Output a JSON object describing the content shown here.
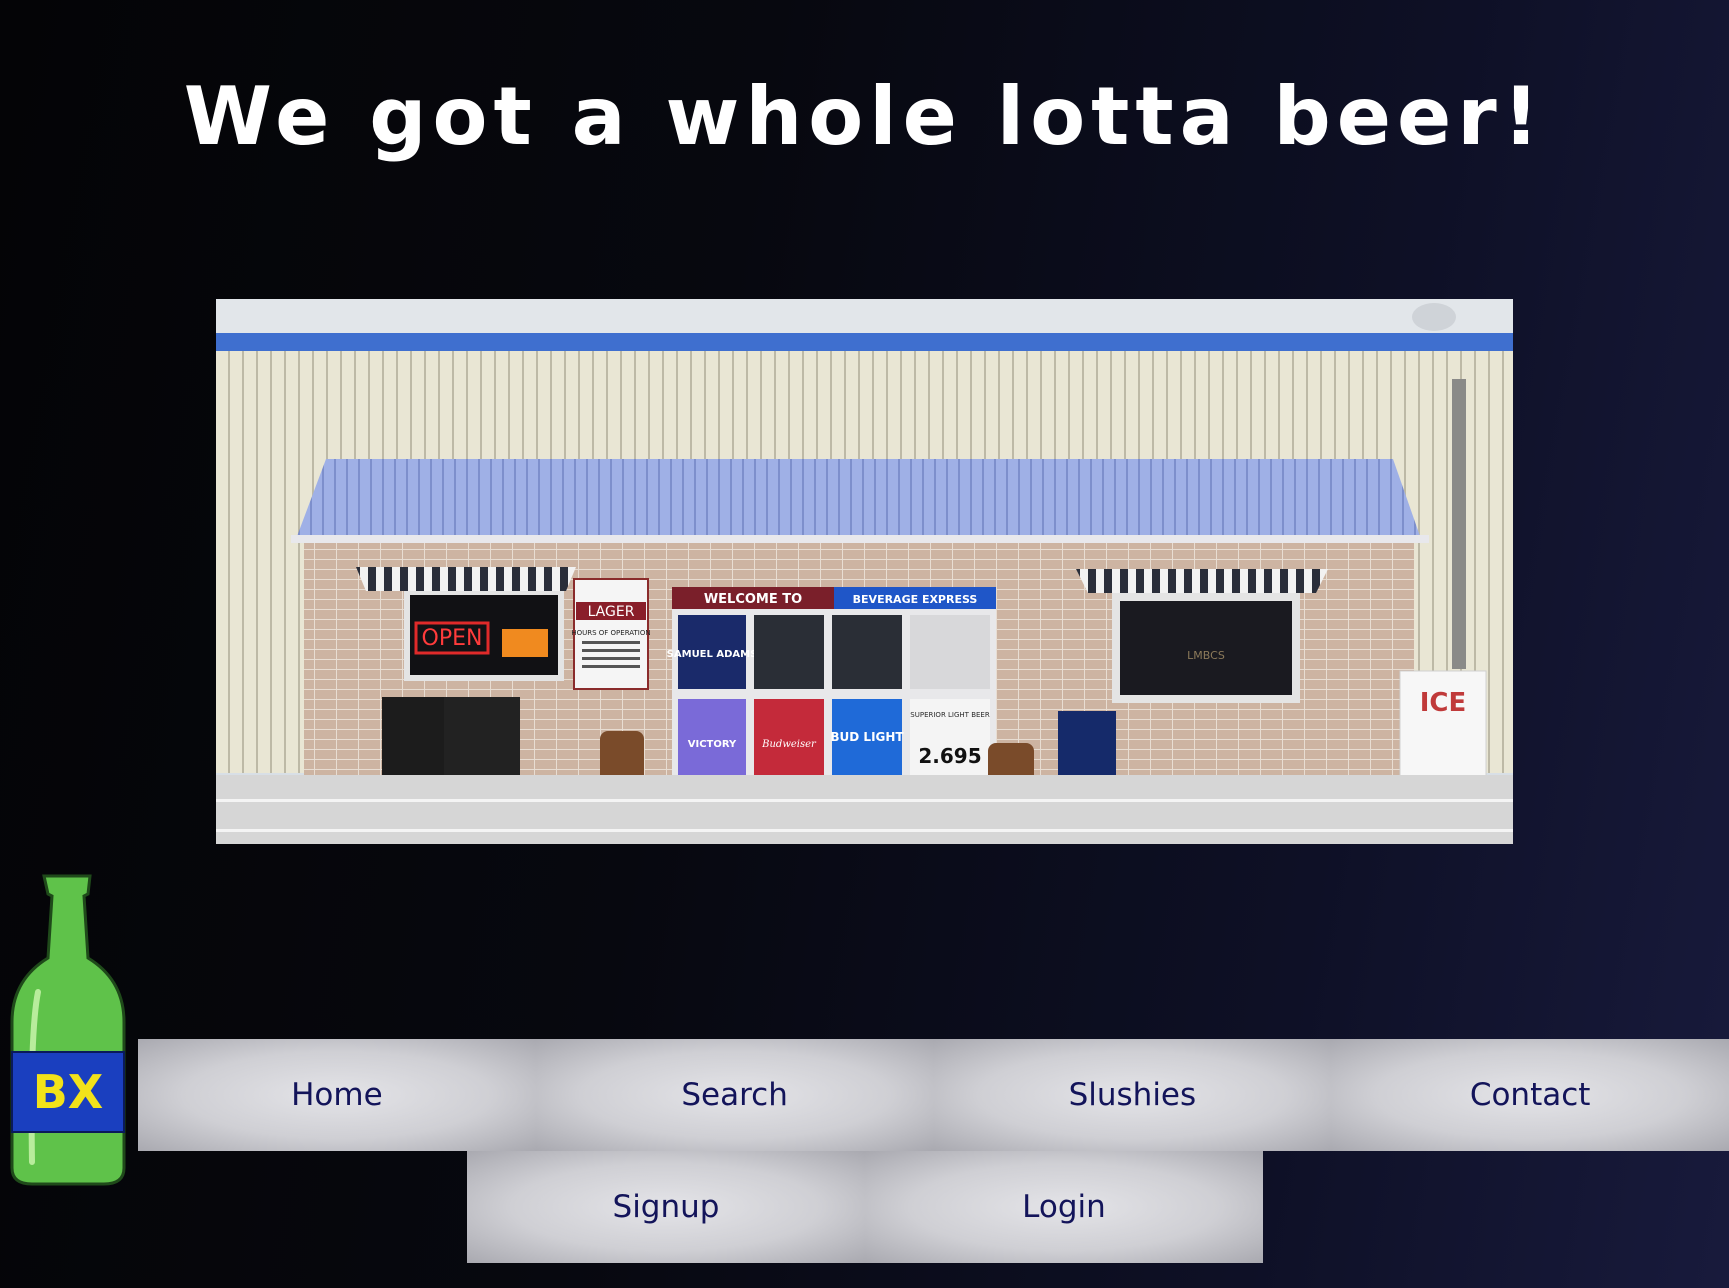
{
  "page": {
    "headline": "We got a whole lotta beer!"
  },
  "storefront": {
    "signs": {
      "welcome": "WELCOME TO",
      "store_name": "BEVERAGE EXPRESS",
      "open": "OPEN",
      "ice": "ICE",
      "lager": "LAGER",
      "hours_title": "HOURS OF OPERATION",
      "sam_adams": "SAMUEL ADAMS",
      "victory": "VICTORY",
      "budweiser": "Budweiser",
      "bud_light": "BUD LIGHT",
      "superior": "SUPERIOR LIGHT BEER",
      "price": "2.695",
      "lmbcs": "LMBCS"
    }
  },
  "logo": {
    "text": "BX"
  },
  "nav": {
    "main": [
      "Home",
      "Search",
      "Slushies",
      "Contact"
    ],
    "sub": [
      "Signup",
      "Login"
    ]
  },
  "colors": {
    "nav_text": "#13145a",
    "nav_bg": "#cfcfd4",
    "bottle": "#5fc24a",
    "label": "#1a3fbf",
    "label_text": "#f2e21a"
  }
}
